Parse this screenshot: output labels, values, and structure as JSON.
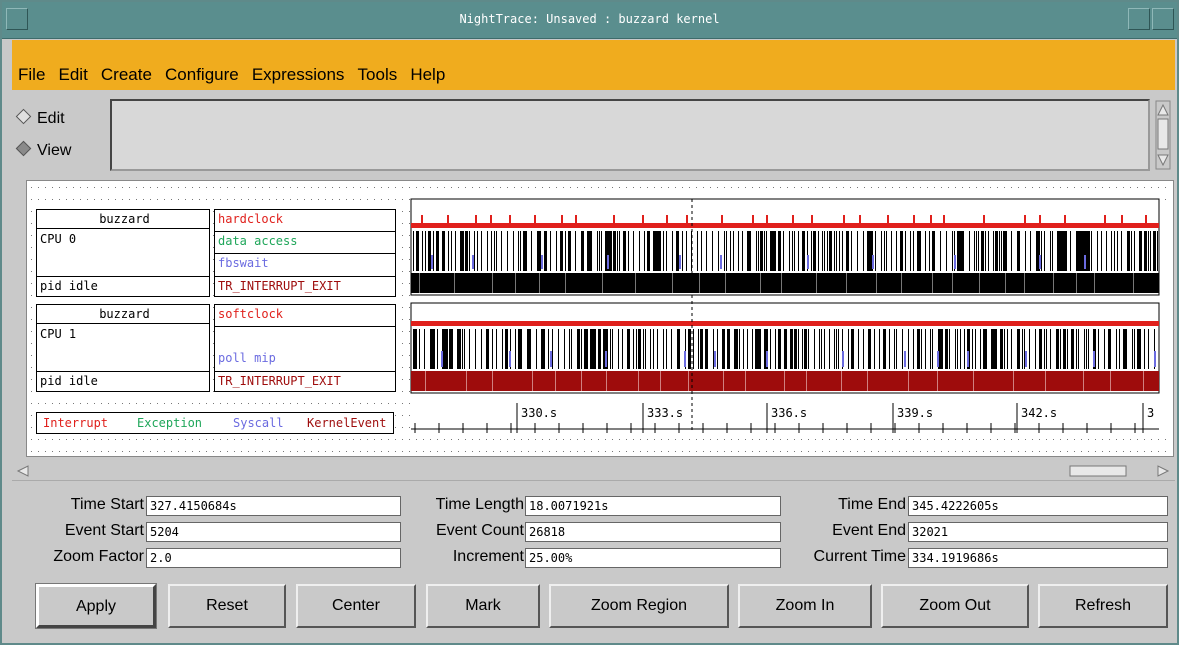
{
  "window": {
    "title": "NightTrace: Unsaved : buzzard kernel"
  },
  "menu": [
    "File",
    "Edit",
    "Create",
    "Configure",
    "Expressions",
    "Tools",
    "Help"
  ],
  "mode": {
    "edit": "Edit",
    "view": "View",
    "selected": "View"
  },
  "groups": [
    {
      "host": "buzzard",
      "cpu": "CPU 0",
      "pid": "pid idle",
      "rows": [
        "hardclock",
        "data access",
        "fbswait",
        "TR_INTERRUPT_EXIT"
      ]
    },
    {
      "host": "buzzard",
      "cpu": "CPU 1",
      "pid": "pid idle",
      "rows": [
        "softclock",
        "",
        "poll mip",
        "TR_INTERRUPT_EXIT"
      ]
    }
  ],
  "legend": [
    "Interrupt",
    "Exception",
    "Syscall",
    "KernelEvent"
  ],
  "colors": {
    "interrupt": "#e0201c",
    "exception": "#1fa65a",
    "syscall": "#6b6be0",
    "kernel_event": "#9e0c0c",
    "menubar": "#f0ac1e",
    "titlebar": "#5a8e8e"
  },
  "timeline": {
    "ticks": [
      "330.s",
      "333.s",
      "336.s",
      "339.s",
      "342.s",
      "3"
    ]
  },
  "fields": {
    "time_start_label": "Time Start",
    "time_start": "327.4150684s",
    "time_length_label": "Time Length",
    "time_length": "18.0071921s",
    "time_end_label": "Time End",
    "time_end": "345.4222605s",
    "event_start_label": "Event Start",
    "event_start": "5204",
    "event_count_label": "Event Count",
    "event_count": "26818",
    "event_end_label": "Event End",
    "event_end": "32021",
    "zoom_factor_label": "Zoom Factor",
    "zoom_factor": "2.0",
    "increment_label": "Increment",
    "increment": "25.00%",
    "current_time_label": "Current Time",
    "current_time": "334.1919686s"
  },
  "buttons": {
    "apply": "Apply",
    "reset": "Reset",
    "center": "Center",
    "mark": "Mark",
    "zoom_region": "Zoom Region",
    "zoom_in": "Zoom In",
    "zoom_out": "Zoom Out",
    "refresh": "Refresh"
  }
}
